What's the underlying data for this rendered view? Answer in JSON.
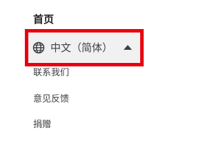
{
  "nav": {
    "home_label": "首页",
    "language": {
      "current": "中文（简体）",
      "icon": "globe-icon",
      "expander_icon": "caret-up-icon",
      "highlight_color": "#e8000f"
    },
    "links": [
      {
        "label": "联系我们"
      },
      {
        "label": "意见反馈"
      },
      {
        "label": "捐赠"
      }
    ]
  }
}
